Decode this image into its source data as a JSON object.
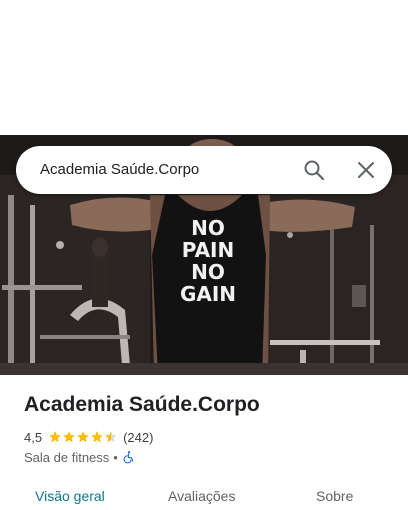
{
  "search": {
    "query": "Academia Saúde.Corpo"
  },
  "hero": {
    "shirt_lines": [
      "NO",
      "PAIN",
      "NO",
      "GAIN"
    ]
  },
  "place": {
    "name": "Academia Saúde.Corpo",
    "rating": "4,5",
    "stars_value": 4.5,
    "stars_max": 5,
    "review_count": "(242)",
    "category": "Sala de fitness",
    "separator": "•"
  },
  "tabs": [
    {
      "label": "Visão geral",
      "active": true
    },
    {
      "label": "Avaliações",
      "active": false
    },
    {
      "label": "Sobre",
      "active": false
    }
  ],
  "colors": {
    "active_tab": "#0b7a8a",
    "star": "#fbbc04",
    "accessibility": "#1a73e8"
  },
  "icons": [
    "search-icon",
    "close-icon",
    "star-icon",
    "wheelchair-icon"
  ]
}
